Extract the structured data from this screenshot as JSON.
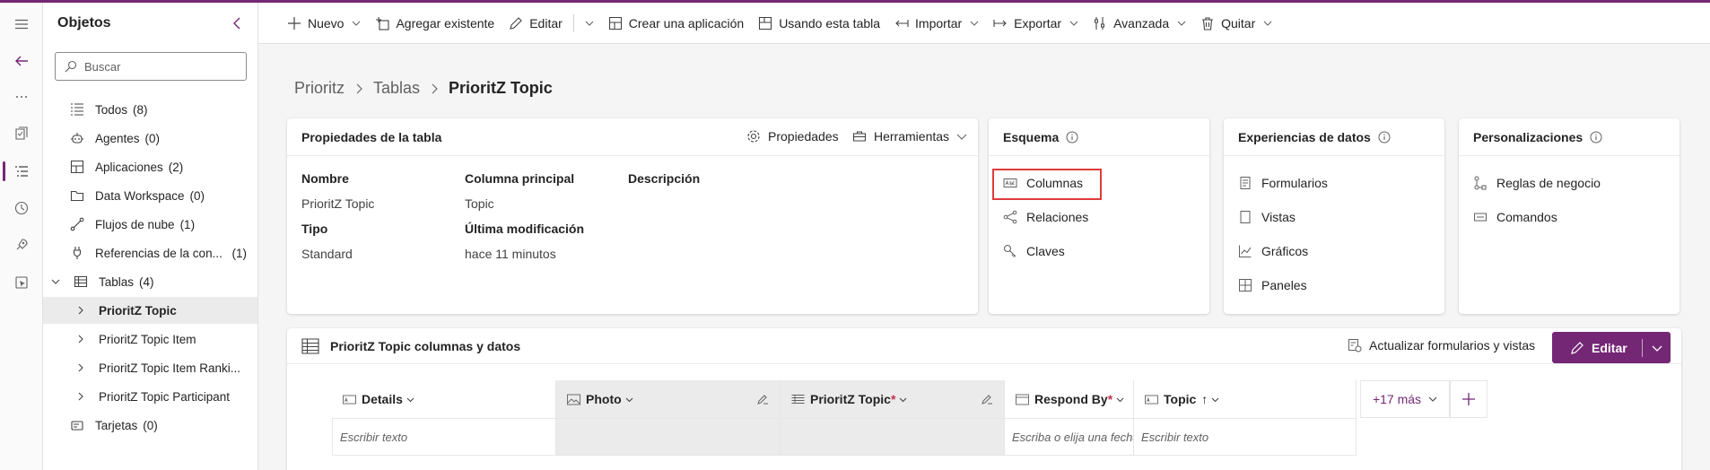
{
  "rail": {
    "items": [
      "menu-icon",
      "back-arrow-icon",
      "more-icon",
      "solutions-icon",
      "objects-icon",
      "history-icon",
      "deploy-icon",
      "pipelines-icon"
    ]
  },
  "objects_panel": {
    "title": "Objetos",
    "search_placeholder": "Buscar",
    "items": [
      {
        "label": "Todos",
        "count": "(8)"
      },
      {
        "label": "Agentes",
        "count": "(0)"
      },
      {
        "label": "Aplicaciones",
        "count": "(2)"
      },
      {
        "label": "Data Workspace",
        "count": "(0)"
      },
      {
        "label": "Flujos de nube",
        "count": "(1)"
      },
      {
        "label": "Referencias de la con...",
        "count": "(1)"
      },
      {
        "label": "Tablas",
        "count": "(4)"
      },
      {
        "label": "PrioritZ Topic",
        "count": ""
      },
      {
        "label": "PrioritZ Topic Item",
        "count": ""
      },
      {
        "label": "PrioritZ Topic Item Ranki...",
        "count": ""
      },
      {
        "label": "PrioritZ Topic Participant",
        "count": ""
      },
      {
        "label": "Tarjetas",
        "count": "(0)"
      }
    ]
  },
  "commandbar": {
    "nuevo": "Nuevo",
    "agregar": "Agregar existente",
    "editar": "Editar",
    "crear_app": "Crear una aplicación",
    "usando_tabla": "Usando esta tabla",
    "importar": "Importar",
    "exportar": "Exportar",
    "avanzada": "Avanzada",
    "quitar": "Quitar"
  },
  "breadcrumb": {
    "root": "Prioritz",
    "mid": "Tablas",
    "current": "PrioritZ Topic"
  },
  "properties_card": {
    "title": "Propiedades de la tabla",
    "propiedades": "Propiedades",
    "herramientas": "Herramientas",
    "nombre_label": "Nombre",
    "nombre_value": "PrioritZ Topic",
    "tipo_label": "Tipo",
    "tipo_value": "Standard",
    "columna_label": "Columna principal",
    "columna_value": "Topic",
    "ultima_label": "Última modificación",
    "ultima_value": "hace 11 minutos",
    "descripcion_label": "Descripción"
  },
  "esquema_card": {
    "title": "Esquema",
    "columnas": "Columnas",
    "relaciones": "Relaciones",
    "claves": "Claves"
  },
  "experiencias_card": {
    "title": "Experiencias de datos",
    "formularios": "Formularios",
    "vistas": "Vistas",
    "graficos": "Gráficos",
    "paneles": "Paneles"
  },
  "personalizaciones_card": {
    "title": "Personalizaciones",
    "reglas": "Reglas de negocio",
    "comandos": "Comandos"
  },
  "data_panel": {
    "title": "PrioritZ Topic columnas y datos",
    "actualizar": "Actualizar formularios y vistas",
    "editar": "Editar",
    "columns": {
      "details": "Details",
      "photo": "Photo",
      "topic_pk": "PrioritZ Topic",
      "respond_by": "Respond By",
      "topic": "Topic",
      "more": "+17 más"
    },
    "placeholders": {
      "details": "Escribir texto",
      "respond_by": "Escriba o elija una fecha",
      "topic": "Escribir texto"
    },
    "required_mark": "*",
    "sort_indicator": "↑"
  },
  "colors": {
    "accent": "#742774",
    "highlight": "#e03b3b"
  }
}
